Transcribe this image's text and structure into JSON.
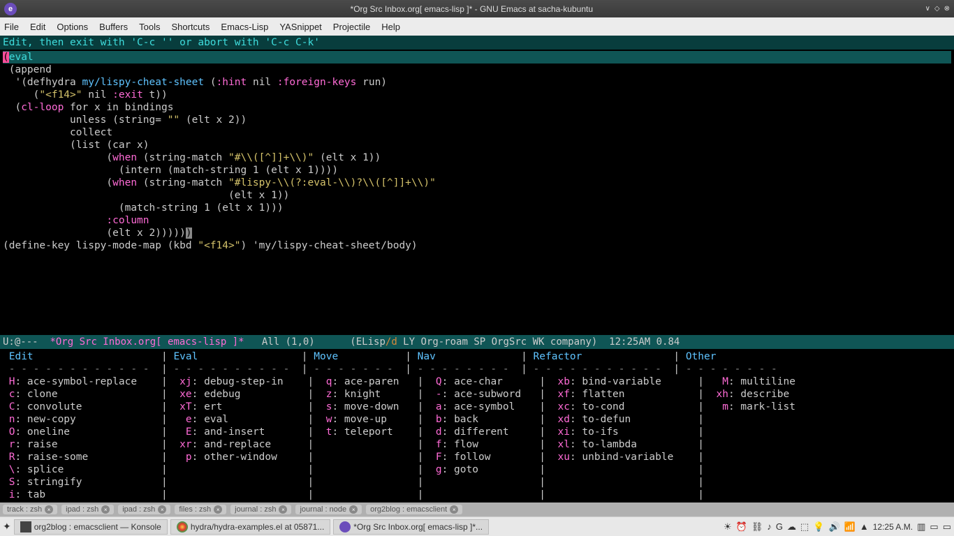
{
  "titlebar": {
    "icon_letter": "e",
    "title": "*Org Src Inbox.org[ emacs-lisp ]* - GNU Emacs at sacha-kubuntu"
  },
  "menubar": [
    "File",
    "Edit",
    "Options",
    "Buffers",
    "Tools",
    "Shortcuts",
    "Emacs-Lisp",
    "YASnippet",
    "Projectile",
    "Help"
  ],
  "hint": "Edit, then exit with 'C-c '' or abort with 'C-c C-k'",
  "code": {
    "l1_eval": "eval",
    "l2": " (append",
    "l3a": "  '(defhydra ",
    "l3b": "my/lispy-cheat-sheet",
    "l3c": " (",
    "l3d": ":hint",
    "l3e": " nil ",
    "l3f": ":foreign-keys",
    "l3g": " run)",
    "l4a": "     (",
    "l4b": "\"<f14>\"",
    "l4c": " nil ",
    "l4d": ":exit",
    "l4e": " t))",
    "l5a": "  (",
    "l5b": "cl-loop",
    "l5c": " for x in bindings",
    "l6": "           unless (string= ",
    "l6s": "\"\"",
    "l6b": " (elt x 2))",
    "l7": "           collect",
    "l8": "           (list (car x)",
    "l9a": "                 (",
    "l9b": "when",
    "l9c": " (string-match ",
    "l9s": "\"#\\\\([^]]+\\\\)\"",
    "l9d": " (elt x 1))",
    "l10": "                   (intern (match-string 1 (elt x 1))))",
    "l11a": "                 (",
    "l11b": "when",
    "l11c": " (string-match ",
    "l11s": "\"#lispy-\\\\(?:eval-\\\\)?\\\\([^]]+\\\\)\"",
    "l12": "                                     (elt x 1))",
    "l13": "                   (match-string 1 (elt x 1)))",
    "l14a": "                 ",
    "l14b": ":column",
    "l15a": "                 (elt x 2)))))",
    "l15cur": ")",
    "l16a": "(define-key lispy-mode-map (kbd ",
    "l16s": "\"<f14>\"",
    "l16b": ") 'my/lispy-cheat-sheet/body)"
  },
  "modeline": {
    "pre": "U:@---  ",
    "buf": "*Org Src Inbox.org[ emacs-lisp ]*",
    "mid": "   All (1,0)      (ELisp",
    "slash": "/d",
    "rest": " LY Org-roam SP OrgSrc WK company)  12:25AM 0.84"
  },
  "hydra": {
    "headers": [
      "Edit",
      "Eval",
      "Move",
      "Nav",
      "Refactor",
      "Other"
    ],
    "dashes_row": " - - - - - - - - - - - - -  | - - - - - - - - - - -  | - - - - - - - -  | - - - - - - - - -  | - - - - - - - - - - - -  | - - - - - - - - ",
    "col1": [
      {
        "k": "H",
        "d": "ace-symbol-replace"
      },
      {
        "k": "c",
        "d": "clone"
      },
      {
        "k": "C",
        "d": "convolute"
      },
      {
        "k": "n",
        "d": "new-copy"
      },
      {
        "k": "O",
        "d": "oneline"
      },
      {
        "k": "r",
        "d": "raise"
      },
      {
        "k": "R",
        "d": "raise-some"
      },
      {
        "k": "\\",
        "d": "splice"
      },
      {
        "k": "S",
        "d": "stringify"
      },
      {
        "k": "i",
        "d": "tab"
      }
    ],
    "col2": [
      {
        "k": "xj",
        "d": "debug-step-in"
      },
      {
        "k": "xe",
        "d": "edebug"
      },
      {
        "k": "xT",
        "d": "ert"
      },
      {
        "k": "e",
        "d": "eval"
      },
      {
        "k": "E",
        "d": "and-insert"
      },
      {
        "k": "xr",
        "d": "and-replace"
      },
      {
        "k": "p",
        "d": "other-window"
      }
    ],
    "col3": [
      {
        "k": "q",
        "d": "ace-paren"
      },
      {
        "k": "z",
        "d": "knight"
      },
      {
        "k": "s",
        "d": "move-down"
      },
      {
        "k": "w",
        "d": "move-up"
      },
      {
        "k": "t",
        "d": "teleport"
      }
    ],
    "col4": [
      {
        "k": "Q",
        "d": "ace-char"
      },
      {
        "k": "-",
        "d": "ace-subword"
      },
      {
        "k": "a",
        "d": "ace-symbol"
      },
      {
        "k": "b",
        "d": "back"
      },
      {
        "k": "d",
        "d": "different"
      },
      {
        "k": "f",
        "d": "flow"
      },
      {
        "k": "F",
        "d": "follow"
      },
      {
        "k": "g",
        "d": "goto"
      }
    ],
    "col5": [
      {
        "k": "xb",
        "d": "bind-variable"
      },
      {
        "k": "xf",
        "d": "flatten"
      },
      {
        "k": "xc",
        "d": "to-cond"
      },
      {
        "k": "xd",
        "d": "to-defun"
      },
      {
        "k": "xi",
        "d": "to-ifs"
      },
      {
        "k": "xl",
        "d": "to-lambda"
      },
      {
        "k": "xu",
        "d": "unbind-variable"
      }
    ],
    "col6": [
      {
        "k": "M",
        "d": "multiline"
      },
      {
        "k": "xh",
        "d": "describe"
      },
      {
        "k": "m",
        "d": "mark-list"
      }
    ]
  },
  "tabs": [
    "track : zsh",
    "ipad : zsh",
    "ipad : zsh",
    "files : zsh",
    "journal : zsh",
    "journal : node",
    "org2blog : emacsclient"
  ],
  "taskbar": {
    "tasks": [
      {
        "label": "org2blog : emacsclient — Konsole"
      },
      {
        "label": "hydra/hydra-examples.el at 05871..."
      },
      {
        "label": "*Org Src Inbox.org[ emacs-lisp ]*..."
      }
    ],
    "clock": "12:25 A.M."
  }
}
